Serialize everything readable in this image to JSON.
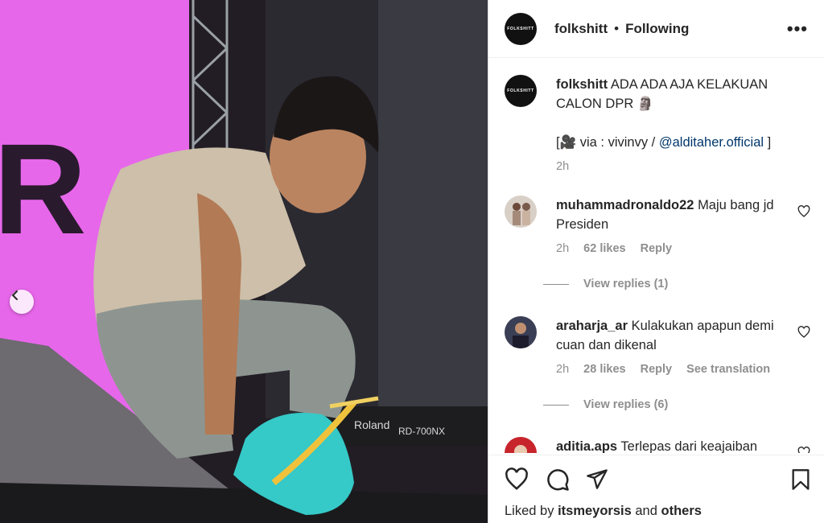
{
  "media": {
    "nav_prev_icon": "chevron-left-icon",
    "backdrop_letter": "R",
    "keyboard_brand": "Roland",
    "keyboard_model": "RD-700NX"
  },
  "header": {
    "avatar_text": "FOLKSHITT",
    "username": "folkshitt",
    "separator": "•",
    "follow_status": "Following",
    "more_icon": "more-icon",
    "more_label": "•••"
  },
  "caption": {
    "username": "folkshitt",
    "text": "ADA ADA AJA KELAKUAN CALON DPR 🗿",
    "credit_open": "[",
    "credit_icon": "🎥",
    "credit_text": "via : vivinvy /",
    "credit_link": "@alditaher.official",
    "credit_close": "]",
    "time": "2h"
  },
  "comments": [
    {
      "username": "muhammadronaldo22",
      "text": "Maju bang jd Presiden",
      "time": "2h",
      "likes": "62 likes",
      "reply": "Reply",
      "view_replies": "View replies (1)"
    },
    {
      "username": "araharja_ar",
      "text": "Kulakukan apapun demi cuan dan dikenal",
      "time": "2h",
      "likes": "28 likes",
      "reply": "Reply",
      "translate": "See translation",
      "view_replies": "View replies (6)"
    },
    {
      "username": "aditia.aps",
      "text": "Terlepas dari keajaiban"
    }
  ],
  "actions": {
    "like_icon": "heart-icon",
    "comment_icon": "comment-icon",
    "share_icon": "send-icon",
    "save_icon": "bookmark-icon"
  },
  "liked_by": {
    "prefix": "Liked by",
    "user": "itsmeyorsis",
    "and": "and",
    "others": "others"
  },
  "colors": {
    "link": "#00376b",
    "muted": "#8e8e8e",
    "stage_pink": "#e25be6"
  }
}
